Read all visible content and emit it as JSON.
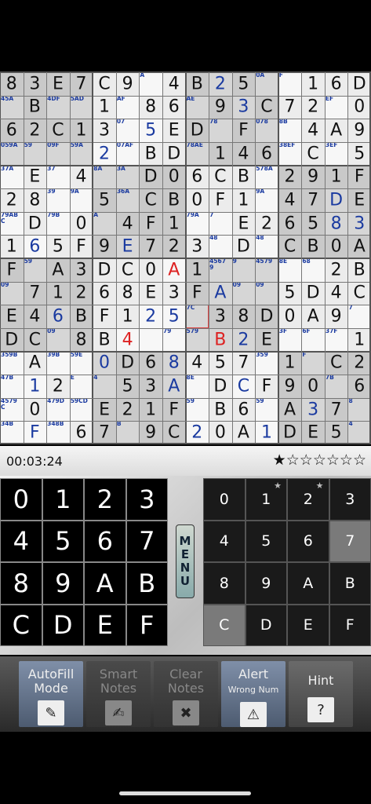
{
  "timer": "00:03:24",
  "difficulty_stars": {
    "filled": 1,
    "total": 7
  },
  "grid": {
    "size": 16,
    "rows": [
      [
        {
          "v": "8"
        },
        {
          "v": "3"
        },
        {
          "v": "E"
        },
        {
          "v": "7"
        },
        {
          "v": "C"
        },
        {
          "v": "9"
        },
        {
          "n": "A"
        },
        {
          "v": "4"
        },
        {
          "v": "B"
        },
        {
          "v": "2",
          "c": "blue"
        },
        {
          "v": "5"
        },
        {
          "n": "0A"
        },
        {
          "n": "F"
        },
        {
          "v": "1"
        },
        {
          "v": "6"
        },
        {
          "v": "D"
        }
      ],
      [
        {
          "n": "45A"
        },
        {
          "v": "B"
        },
        {
          "n": "4DF"
        },
        {
          "n": "5AD"
        },
        {
          "v": "1"
        },
        {
          "n": "AF"
        },
        {
          "v": "8"
        },
        {
          "v": "6"
        },
        {
          "n": "AE"
        },
        {
          "v": "9"
        },
        {
          "v": "3",
          "c": "blue"
        },
        {
          "v": "C"
        },
        {
          "v": "7"
        },
        {
          "v": "2"
        },
        {
          "n": "EF"
        },
        {
          "v": "0"
        }
      ],
      [
        {
          "v": "6"
        },
        {
          "v": "2"
        },
        {
          "v": "C"
        },
        {
          "v": "1"
        },
        {
          "v": "3"
        },
        {
          "n": "07"
        },
        {
          "v": "5",
          "c": "blue"
        },
        {
          "v": "E"
        },
        {
          "v": "D"
        },
        {
          "n": "78"
        },
        {
          "v": "F"
        },
        {
          "n": "078"
        },
        {
          "n": "8B"
        },
        {
          "v": "4"
        },
        {
          "v": "A"
        },
        {
          "v": "9"
        }
      ],
      [
        {
          "n": "059A"
        },
        {
          "n": "59"
        },
        {
          "n": "09F"
        },
        {
          "n": "59A"
        },
        {
          "v": "2",
          "c": "blue"
        },
        {
          "n": "07AF"
        },
        {
          "v": "B"
        },
        {
          "v": "D"
        },
        {
          "n": "78AE"
        },
        {
          "v": "1"
        },
        {
          "v": "4"
        },
        {
          "v": "6"
        },
        {
          "n": "38EF"
        },
        {
          "v": "C"
        },
        {
          "n": "3EF"
        },
        {
          "v": "5"
        }
      ],
      [
        {
          "n": "37A"
        },
        {
          "v": "E"
        },
        {
          "n": "37"
        },
        {
          "v": "4"
        },
        {
          "n": "8A"
        },
        {
          "n": "3A"
        },
        {
          "v": "D"
        },
        {
          "v": "0"
        },
        {
          "v": "6"
        },
        {
          "v": "C"
        },
        {
          "v": "B"
        },
        {
          "n": "578A"
        },
        {
          "v": "2"
        },
        {
          "v": "9"
        },
        {
          "v": "1"
        },
        {
          "v": "F"
        }
      ],
      [
        {
          "v": "2"
        },
        {
          "v": "8"
        },
        {
          "n": "39"
        },
        {
          "n": "9A"
        },
        {
          "v": "5"
        },
        {
          "n": "36A"
        },
        {
          "v": "C"
        },
        {
          "v": "B"
        },
        {
          "v": "0"
        },
        {
          "v": "F"
        },
        {
          "v": "1"
        },
        {
          "n": "9A"
        },
        {
          "v": "4"
        },
        {
          "v": "7"
        },
        {
          "v": "D",
          "c": "blue"
        },
        {
          "v": "E"
        }
      ],
      [
        {
          "n": "79AB C"
        },
        {
          "v": "D"
        },
        {
          "n": "79B"
        },
        {
          "v": "0"
        },
        {
          "n": "A"
        },
        {
          "v": "4"
        },
        {
          "v": "F"
        },
        {
          "v": "1"
        },
        {
          "n": "79A"
        },
        {
          "n": "7"
        },
        {
          "v": "E"
        },
        {
          "v": "2"
        },
        {
          "v": "6"
        },
        {
          "v": "5"
        },
        {
          "v": "8",
          "c": "blue"
        },
        {
          "v": "3",
          "c": "blue"
        }
      ],
      [
        {
          "v": "1"
        },
        {
          "v": "6",
          "c": "blue"
        },
        {
          "v": "5"
        },
        {
          "v": "F"
        },
        {
          "v": "9"
        },
        {
          "v": "E",
          "c": "blue"
        },
        {
          "v": "7"
        },
        {
          "v": "2"
        },
        {
          "v": "3"
        },
        {
          "n": "48"
        },
        {
          "v": "D"
        },
        {
          "n": "48"
        },
        {
          "v": "C"
        },
        {
          "v": "B"
        },
        {
          "v": "0"
        },
        {
          "v": "A"
        }
      ],
      [
        {
          "v": "F"
        },
        {
          "n": "59"
        },
        {
          "v": "A"
        },
        {
          "v": "3"
        },
        {
          "v": "D"
        },
        {
          "v": "C"
        },
        {
          "v": "0"
        },
        {
          "v": "A",
          "c": "red"
        },
        {
          "v": "1"
        },
        {
          "n": "4567 9"
        },
        {
          "n": "9"
        },
        {
          "n": "4579"
        },
        {
          "n": "8E"
        },
        {
          "n": "68"
        },
        {
          "v": "2"
        },
        {
          "v": "B"
        }
      ],
      [
        {
          "n": "09"
        },
        {
          "v": "7"
        },
        {
          "v": "1"
        },
        {
          "v": "2"
        },
        {
          "v": "6"
        },
        {
          "v": "8"
        },
        {
          "v": "E"
        },
        {
          "v": "3"
        },
        {
          "v": "F"
        },
        {
          "v": "A",
          "c": "blue"
        },
        {
          "n": "09"
        },
        {
          "n": "09"
        },
        {
          "v": "5"
        },
        {
          "v": "D"
        },
        {
          "v": "4"
        },
        {
          "v": "C"
        }
      ],
      [
        {
          "v": "E"
        },
        {
          "v": "4"
        },
        {
          "v": "6",
          "c": "blue"
        },
        {
          "v": "B"
        },
        {
          "v": "F"
        },
        {
          "v": "1"
        },
        {
          "v": "2",
          "c": "blue"
        },
        {
          "v": "5",
          "c": "blue"
        },
        {
          "n": "7C",
          "sel": true
        },
        {
          "v": "3"
        },
        {
          "v": "8"
        },
        {
          "v": "D"
        },
        {
          "v": "0"
        },
        {
          "v": "A"
        },
        {
          "v": "9"
        },
        {
          "n": "7"
        }
      ],
      [
        {
          "v": "D"
        },
        {
          "v": "C"
        },
        {
          "n": "09"
        },
        {
          "v": "8"
        },
        {
          "v": "B"
        },
        {
          "v": "4",
          "c": "red"
        },
        {
          "n": ""
        },
        {
          "n": "79"
        },
        {
          "n": "579"
        },
        {
          "v": "B",
          "c": "red"
        },
        {
          "v": "2",
          "c": "blue"
        },
        {
          "v": "E"
        },
        {
          "n": "3F"
        },
        {
          "n": "6F"
        },
        {
          "n": "37F"
        },
        {
          "v": "1"
        }
      ],
      [
        {
          "n": "359B"
        },
        {
          "v": "A"
        },
        {
          "n": "39B"
        },
        {
          "n": "59E"
        },
        {
          "v": "0",
          "c": "blue"
        },
        {
          "v": "D"
        },
        {
          "v": "6"
        },
        {
          "v": "8",
          "c": "blue"
        },
        {
          "v": "4"
        },
        {
          "v": "5"
        },
        {
          "v": "7"
        },
        {
          "n": "359"
        },
        {
          "v": "1"
        },
        {
          "n": "F"
        },
        {
          "v": "C"
        },
        {
          "v": "2"
        }
      ],
      [
        {
          "n": "47B"
        },
        {
          "v": "1",
          "c": "blue"
        },
        {
          "v": "2"
        },
        {
          "n": "E"
        },
        {
          "n": "4"
        },
        {
          "v": "5"
        },
        {
          "v": "3"
        },
        {
          "v": "A",
          "c": "blue"
        },
        {
          "n": "8E"
        },
        {
          "v": "D"
        },
        {
          "v": "C",
          "c": "blue"
        },
        {
          "v": "F"
        },
        {
          "v": "9"
        },
        {
          "v": "0"
        },
        {
          "n": "7B"
        },
        {
          "v": "6"
        }
      ],
      [
        {
          "n": "4579 C"
        },
        {
          "v": "0"
        },
        {
          "n": "479D"
        },
        {
          "n": "59CD"
        },
        {
          "v": "E"
        },
        {
          "v": "2"
        },
        {
          "v": "1"
        },
        {
          "v": "F"
        },
        {
          "n": "59"
        },
        {
          "v": "B"
        },
        {
          "v": "6"
        },
        {
          "n": "59"
        },
        {
          "v": "A"
        },
        {
          "v": "3",
          "c": "blue"
        },
        {
          "v": "7"
        },
        {
          "n": "8"
        }
      ],
      [
        {
          "n": "34B"
        },
        {
          "v": "F",
          "c": "blue"
        },
        {
          "n": "348B"
        },
        {
          "v": "6"
        },
        {
          "v": "7"
        },
        {
          "n": "B"
        },
        {
          "v": "9"
        },
        {
          "v": "C"
        },
        {
          "v": "2",
          "c": "blue"
        },
        {
          "v": "0"
        },
        {
          "v": "A"
        },
        {
          "v": "1",
          "c": "blue"
        },
        {
          "v": "D"
        },
        {
          "v": "E"
        },
        {
          "v": "5"
        },
        {
          "n": "4"
        }
      ]
    ]
  },
  "left_keypad": [
    "0",
    "1",
    "2",
    "3",
    "4",
    "5",
    "6",
    "7",
    "8",
    "9",
    "A",
    "B",
    "C",
    "D",
    "E",
    "F"
  ],
  "right_keypad": [
    {
      "k": "0"
    },
    {
      "k": "1",
      "star": true
    },
    {
      "k": "2",
      "star": true
    },
    {
      "k": "3"
    },
    {
      "k": "4"
    },
    {
      "k": "5"
    },
    {
      "k": "6"
    },
    {
      "k": "7",
      "grey": true
    },
    {
      "k": "8"
    },
    {
      "k": "9"
    },
    {
      "k": "A"
    },
    {
      "k": "B"
    },
    {
      "k": "C",
      "grey": true
    },
    {
      "k": "D"
    },
    {
      "k": "E"
    },
    {
      "k": "F"
    }
  ],
  "menu_label": [
    "M",
    "E",
    "N",
    "U"
  ],
  "toolbar": {
    "autofill": [
      "AutoFill",
      "Mode"
    ],
    "smart_notes": [
      "Smart",
      "Notes"
    ],
    "clear_notes": [
      "Clear",
      "Notes"
    ],
    "alert": [
      "Alert",
      "Wrong Num"
    ],
    "hint": "Hint"
  }
}
